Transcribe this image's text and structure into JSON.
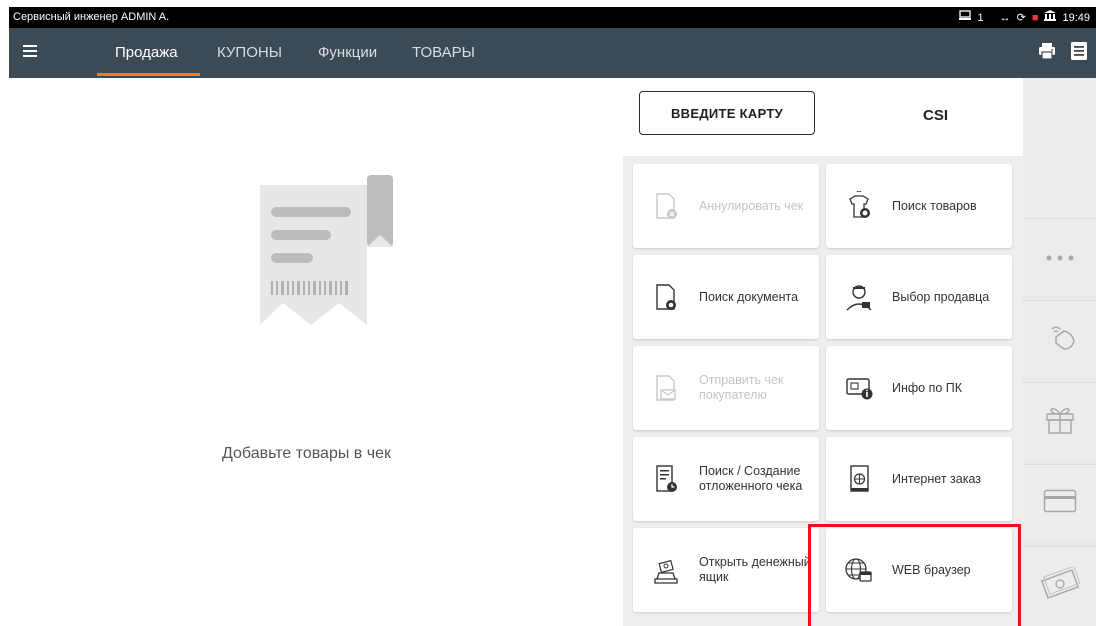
{
  "statusbar": {
    "user": "Сервисный инженер ADMIN A.",
    "register": "1",
    "time": "19:49"
  },
  "tabs": [
    {
      "label": "Продажа",
      "active": true
    },
    {
      "label": "КУПОНЫ",
      "active": false
    },
    {
      "label": "Функции",
      "active": false
    },
    {
      "label": "ТОВАРЫ",
      "active": false
    }
  ],
  "receipt": {
    "empty_text": "Добавьте товары в чек"
  },
  "top": {
    "card_button": "ВВЕДИТЕ КАРТУ",
    "csi": "CSI"
  },
  "tiles": [
    {
      "label": "Аннулировать чек",
      "icon": "cancel-receipt-icon",
      "disabled": true
    },
    {
      "label": "Поиск товаров",
      "icon": "search-goods-icon",
      "disabled": false
    },
    {
      "label": "Поиск документа",
      "icon": "search-document-icon",
      "disabled": false
    },
    {
      "label": "Выбор продавца",
      "icon": "seller-icon",
      "disabled": false
    },
    {
      "label": "Отправить чек покупателю",
      "icon": "send-receipt-icon",
      "disabled": true
    },
    {
      "label": "Инфо по ПК",
      "icon": "card-info-icon",
      "disabled": false
    },
    {
      "label": "Поиск / Создание отложенного чека",
      "icon": "deferred-receipt-icon",
      "disabled": false
    },
    {
      "label": "Интернет заказ",
      "icon": "internet-order-icon",
      "disabled": false
    },
    {
      "label": "Открыть денежный ящик",
      "icon": "cash-drawer-icon",
      "disabled": false
    },
    {
      "label": "WEB браузер",
      "icon": "web-browser-icon",
      "disabled": false
    }
  ],
  "side_icons": [
    "more-icon",
    "contactless-icon",
    "gift-icon",
    "card-icon",
    "cash-icon"
  ],
  "colors": {
    "accent": "#ff7a1a",
    "appbar": "#3c4a55",
    "highlight": "#e8141b"
  }
}
